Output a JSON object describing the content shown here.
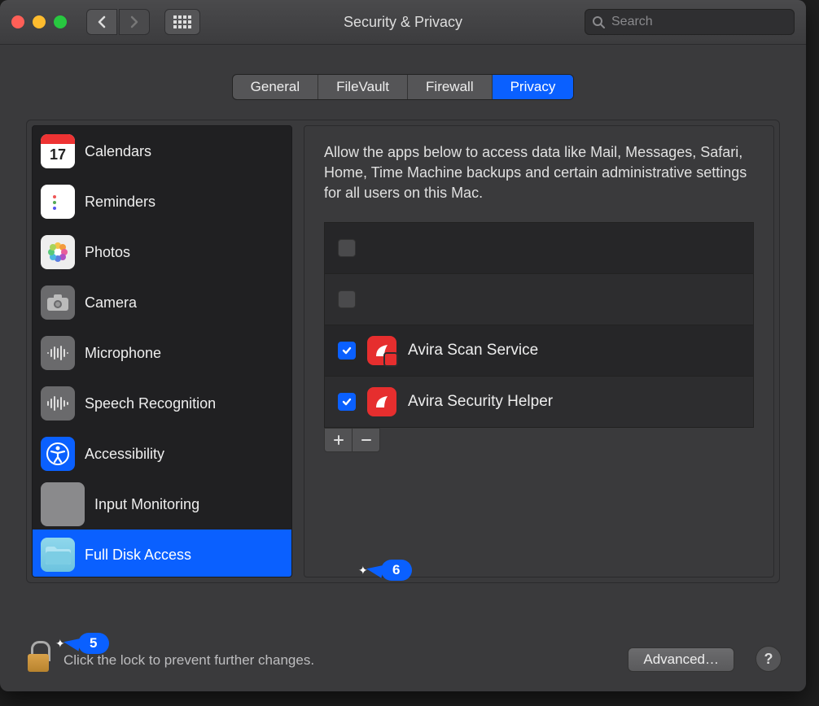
{
  "window": {
    "title": "Security & Privacy"
  },
  "search": {
    "placeholder": "Search"
  },
  "tabs": {
    "items": [
      {
        "label": "General",
        "active": false
      },
      {
        "label": "FileVault",
        "active": false
      },
      {
        "label": "Firewall",
        "active": false
      },
      {
        "label": "Privacy",
        "active": true
      }
    ]
  },
  "sidebar": {
    "items": [
      {
        "label": "Calendars",
        "icon": "calendar-icon",
        "selected": false
      },
      {
        "label": "Reminders",
        "icon": "reminders-icon",
        "selected": false
      },
      {
        "label": "Photos",
        "icon": "photos-icon",
        "selected": false
      },
      {
        "label": "Camera",
        "icon": "camera-icon",
        "selected": false
      },
      {
        "label": "Microphone",
        "icon": "microphone-icon",
        "selected": false
      },
      {
        "label": "Speech Recognition",
        "icon": "waveform-icon",
        "selected": false
      },
      {
        "label": "Accessibility",
        "icon": "accessibility-icon",
        "selected": false
      },
      {
        "label": "Input Monitoring",
        "icon": "keyboard-icon",
        "selected": false
      },
      {
        "label": "Full Disk Access",
        "icon": "folder-icon",
        "selected": true
      }
    ]
  },
  "detail": {
    "description": "Allow the apps below to access data like Mail, Messages, Safari, Home, Time Machine backups and certain administrative settings for all users on this Mac.",
    "apps": [
      {
        "name": "",
        "checked": false,
        "icon": ""
      },
      {
        "name": "",
        "checked": false,
        "icon": ""
      },
      {
        "name": "Avira Scan Service",
        "checked": true,
        "icon": "avira-config-icon"
      },
      {
        "name": "Avira Security Helper",
        "checked": true,
        "icon": "avira-icon"
      }
    ]
  },
  "footer": {
    "lock_text": "Click the lock to prevent further changes.",
    "advanced_label": "Advanced…",
    "help_label": "?"
  },
  "callouts": {
    "five": "5",
    "six": "6"
  },
  "calendar_day": "17"
}
